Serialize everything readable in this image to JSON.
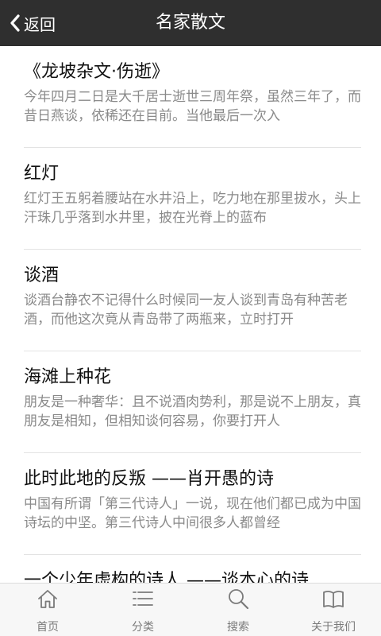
{
  "header": {
    "back_label": "返回",
    "title": "名家散文"
  },
  "articles": [
    {
      "title": "《龙坡杂文·伤逝》",
      "excerpt": "今年四月二日是大千居士逝世三周年祭，虽然三年了，而昔日燕谈，依稀还在目前。当他最后一次入"
    },
    {
      "title": "红灯",
      "excerpt": "红灯王五躬着腰站在水井沿上，吃力地在那里拔水，头上汗珠几乎落到水井里，披在光脊上的蓝布"
    },
    {
      "title": "谈酒",
      "excerpt": "谈酒台静农不记得什么时候同一友人谈到青岛有种苦老酒，而他这次竟从青岛带了两瓶来，立时打开"
    },
    {
      "title": "海滩上种花",
      "excerpt": "朋友是一种奢华：且不说酒肉势利，那是说不上朋友，真朋友是相知，但相知谈何容易，你要打开人"
    },
    {
      "title": "此时此地的反叛 ——肖开愚的诗",
      "excerpt": "中国有所谓「第三代诗人」一说，现在他们都已成为中国诗坛的中坚。第三代诗人中间很多人都曾经"
    },
    {
      "title": "一个少年虚构的诗人 ——谈本心的诗",
      "excerpt": ""
    }
  ],
  "tabbar": {
    "items": [
      {
        "label": "首页",
        "icon": "home-icon"
      },
      {
        "label": "分类",
        "icon": "list-icon"
      },
      {
        "label": "搜索",
        "icon": "search-icon"
      },
      {
        "label": "关于我们",
        "icon": "book-icon"
      }
    ]
  },
  "colors": {
    "header_bg": "#2f2f2f",
    "tabbar_bg": "#f7f7f7",
    "title_text": "#111111",
    "excerpt_text": "#8a8a8a"
  }
}
